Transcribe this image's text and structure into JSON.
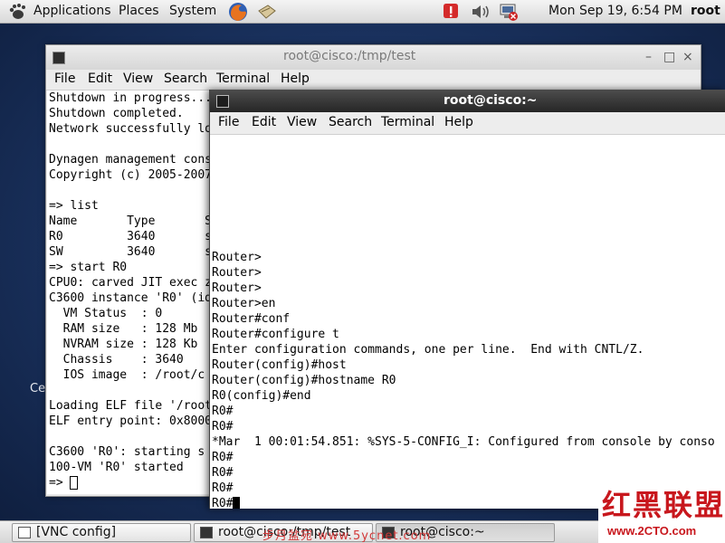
{
  "top_panel": {
    "menus": [
      "Applications",
      "Places",
      "System"
    ],
    "clock": "Mon Sep 19,  6:54 PM",
    "user": "root"
  },
  "desktop": {
    "fragment": "Ce"
  },
  "window_back": {
    "title": "root@cisco:/tmp/test",
    "menu": [
      "File",
      "Edit",
      "View",
      "Search",
      "Terminal",
      "Help"
    ],
    "controls": [
      "–",
      "□",
      "×"
    ],
    "lines": [
      "Shutdown in progress...",
      "Shutdown completed.",
      "Network successfully lo",
      "",
      "Dynagen management cons",
      "Copyright (c) 2005-2007",
      "",
      "=> list",
      "Name       Type       S",
      "R0         3640       s",
      "SW         3640       s",
      "=> start R0",
      "CPU0: carved JIT exec z",
      "C3600 instance 'R0' (id",
      "  VM Status  : 0",
      "  RAM size   : 128 Mb",
      "  NVRAM size : 128 Kb",
      "  Chassis    : 3640",
      "  IOS image  : /root/c",
      "",
      "Loading ELF file '/root",
      "ELF entry point: 0x8000",
      "",
      "C3600 'R0': starting s",
      "100-VM 'R0' started",
      "=> "
    ]
  },
  "window_front": {
    "title": "root@cisco:~",
    "menu": [
      "File",
      "Edit",
      "View",
      "Search",
      "Terminal",
      "Help"
    ],
    "lines": [
      "",
      "",
      "",
      "",
      "",
      "",
      "",
      "",
      "Router>",
      "Router>",
      "Router>",
      "Router>en",
      "Router#conf",
      "Router#configure t",
      "Enter configuration commands, one per line.  End with CNTL/Z.",
      "Router(config)#host",
      "Router(config)#hostname R0",
      "R0(config)#end",
      "R0#",
      "R0#",
      "*Mar  1 00:01:54.851: %SYS-5-CONFIG_I: Configured from console by conso",
      "R0#",
      "R0#",
      "R0#",
      "R0#"
    ]
  },
  "taskbar": {
    "items": [
      "[VNC config]",
      "root@cisco:/tmp/test",
      "root@cisco:~"
    ]
  },
  "watermark": {
    "overlay": "步月盆宛  www.5ycnet.com",
    "logo": "红黑联盟",
    "url": "www.2CTO.com"
  }
}
